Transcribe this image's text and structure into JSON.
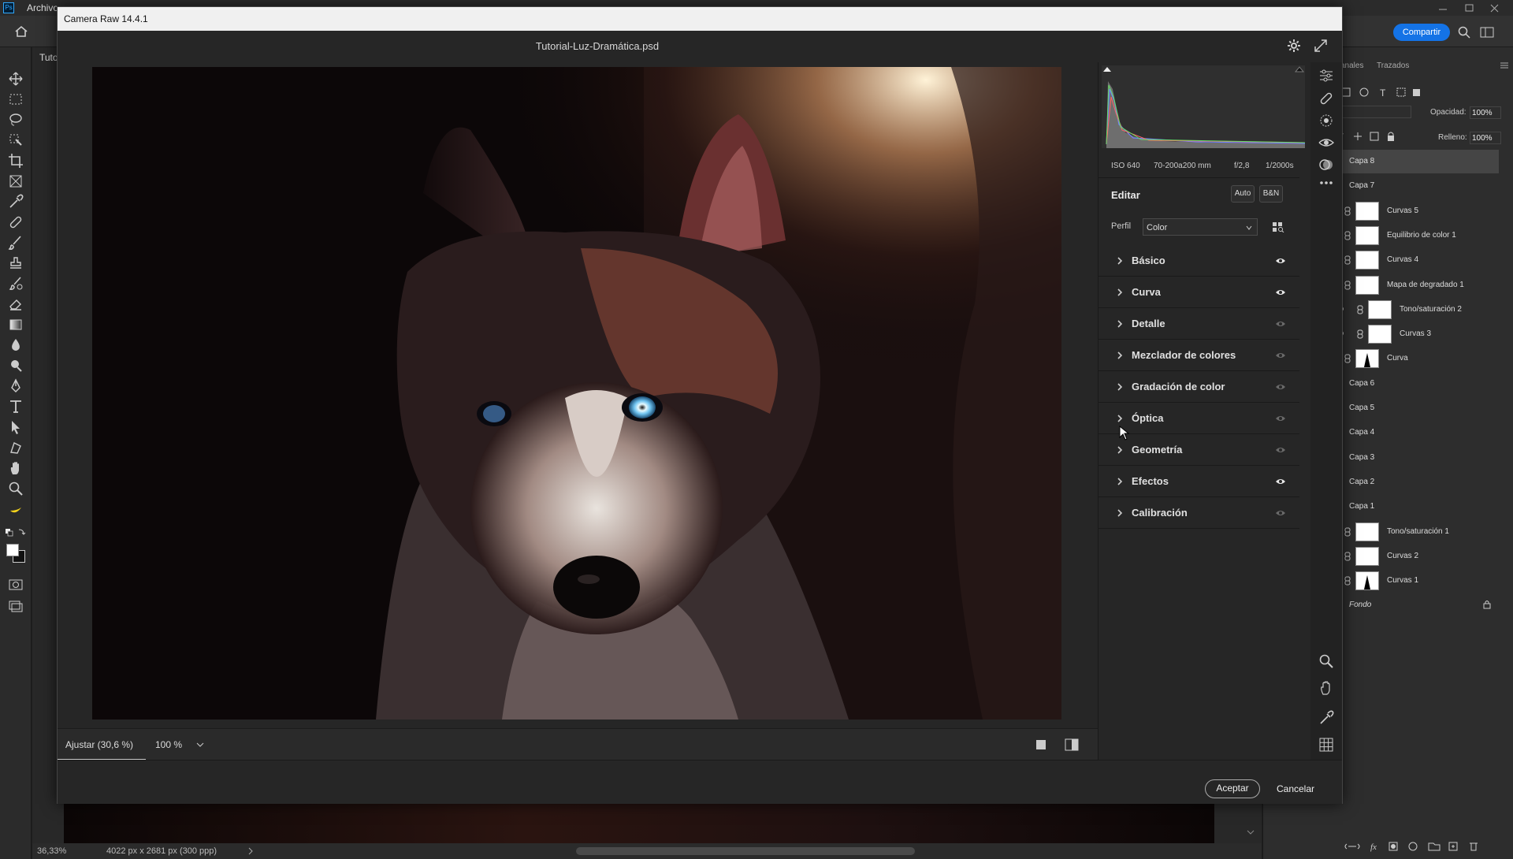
{
  "ps": {
    "menu": {
      "first": "Archivo"
    },
    "doc_tab": "Tuto",
    "share_button": "Compartir",
    "status": {
      "zoom": "36,33%",
      "dimensions": "4022 px x 2681 px (300 ppp)"
    },
    "panel_tabs": [
      "anales",
      "Trazados"
    ],
    "opacity_label": "Opacidad:",
    "opacity_value": "100%",
    "fill_label": "Relleno:",
    "fill_value": "100%",
    "layers": [
      {
        "name": "Capa 8",
        "thumb": false,
        "selected": true
      },
      {
        "name": "Capa 7",
        "thumb": false
      },
      {
        "name": "Curvas 5",
        "thumb": true
      },
      {
        "name": "Equilibrio de color 1",
        "thumb": true
      },
      {
        "name": "Curvas 4",
        "thumb": true
      },
      {
        "name": "Mapa de degradado 1",
        "thumb": true
      },
      {
        "name": "Tono/saturación 2",
        "thumb": true,
        "indented": true
      },
      {
        "name": "Curvas 3",
        "thumb": true,
        "indented": true
      },
      {
        "name": "Curva",
        "thumb": true,
        "dark_thumb": true
      },
      {
        "name": "Capa 6",
        "thumb": false
      },
      {
        "name": "Capa 5",
        "thumb": false
      },
      {
        "name": "Capa 4",
        "thumb": false
      },
      {
        "name": "Capa 3",
        "thumb": false
      },
      {
        "name": "Capa 2",
        "thumb": false
      },
      {
        "name": "Capa 1",
        "thumb": false
      },
      {
        "name": "Tono/saturación 1",
        "thumb": true
      },
      {
        "name": "Curvas 2",
        "thumb": true
      },
      {
        "name": "Curvas 1",
        "thumb": true,
        "dark_thumb": true
      },
      {
        "name": "Fondo",
        "thumb": false,
        "italic": true,
        "locked": true
      }
    ]
  },
  "cr": {
    "window_title": "Camera Raw 14.4.1",
    "filename": "Tutorial-Luz-Dramática.psd",
    "exif": {
      "iso": "ISO 640",
      "lens": "70-200a200 mm",
      "aperture": "f/2,8",
      "shutter": "1/2000s"
    },
    "edit_label": "Editar",
    "auto_button": "Auto",
    "bw_button": "B&N",
    "profile_label": "Perfil",
    "profile_value": "Color",
    "sections": [
      {
        "label": "Básico",
        "visible": true
      },
      {
        "label": "Curva",
        "visible": true
      },
      {
        "label": "Detalle",
        "visible": false
      },
      {
        "label": "Mezclador de colores",
        "visible": false
      },
      {
        "label": "Gradación de color",
        "visible": false
      },
      {
        "label": "Óptica",
        "visible": false
      },
      {
        "label": "Geometría",
        "visible": false
      },
      {
        "label": "Efectos",
        "visible": true
      },
      {
        "label": "Calibración",
        "visible": false
      }
    ],
    "fit_label": "Ajustar (30,6 %)",
    "zoom_label": "100 %",
    "accept_button": "Aceptar",
    "cancel_button": "Cancelar"
  },
  "colors": {
    "accent_blue": "#1473e6",
    "eye_blue": "#6fc3f0"
  }
}
